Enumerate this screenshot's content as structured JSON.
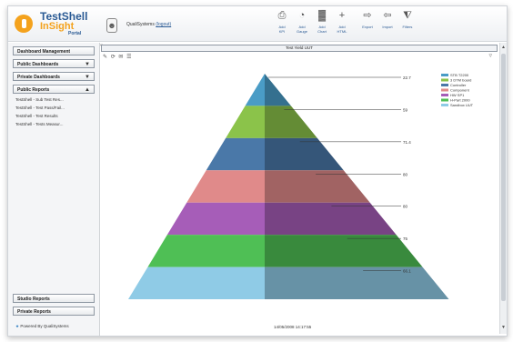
{
  "header": {
    "logo_line1": "TestShell",
    "logo_line2": "InSight",
    "logo_portal": "Portal",
    "user_text": "QualiSystems",
    "logout": "(logout)",
    "toolbar": [
      {
        "icon": "add-kpi-icon",
        "glyph": "⎙",
        "label1": "Add",
        "label2": "KPI"
      },
      {
        "icon": "add-gauge-icon",
        "glyph": "◔",
        "label1": "Add",
        "label2": "Gauge"
      },
      {
        "icon": "add-chart-icon",
        "glyph": "▓",
        "label1": "Add",
        "label2": "Chart"
      },
      {
        "icon": "add-html-icon",
        "glyph": "+",
        "label1": "Add",
        "label2": "HTML"
      },
      {
        "icon": "export-icon",
        "glyph": "⇨",
        "label1": "Export",
        "label2": ""
      },
      {
        "icon": "import-icon",
        "glyph": "⇦",
        "label1": "Import",
        "label2": ""
      },
      {
        "icon": "filters-icon",
        "glyph": "⧨",
        "label1": "Filters",
        "label2": ""
      }
    ]
  },
  "sidebar": {
    "dashboard_management": "Dashboard Management",
    "public_dashboards": "Public Dashboards",
    "private_dashboards": "Private Dashboards",
    "public_reports": "Public Reports",
    "reports": [
      "TestShell - Sub Test Res...",
      "TestShell - Test Pass/Fail...",
      "TestShell - Test Results",
      "TestShell - Tests Measur..."
    ],
    "studio_reports": "Studio Reports",
    "private_reports": "Private Reports",
    "powered_by": "Powered By QualiSystems"
  },
  "main": {
    "panel_title": "Test Yield UUT",
    "tools": "✎ ⟳ ✉ ☰",
    "date": "14/05/2008 14:17:55"
  },
  "chart_data": {
    "type": "pyramid",
    "title": "Test Yield UUT",
    "layers": [
      {
        "name": "STB T2200",
        "value": 22.7,
        "color": "#4a9cc6"
      },
      {
        "name": "3 DTM board",
        "value": 59,
        "color": "#8bc34a"
      },
      {
        "name": "Controller",
        "value": 71.4,
        "color": "#4a78a8"
      },
      {
        "name": "Component",
        "value": 80,
        "color": "#e08a8a"
      },
      {
        "name": "HW SP1",
        "value": 80,
        "color": "#a65db8"
      },
      {
        "name": "H-Part 2000",
        "value": 75,
        "color": "#4fbf55"
      },
      {
        "name": "Sandbox UUT",
        "value": 66.1,
        "color": "#8fcbe6"
      }
    ],
    "labels": [
      "22.7",
      "59",
      "71.4",
      "80",
      "80",
      "75",
      "66.1"
    ],
    "legend_placement": "top-right"
  }
}
